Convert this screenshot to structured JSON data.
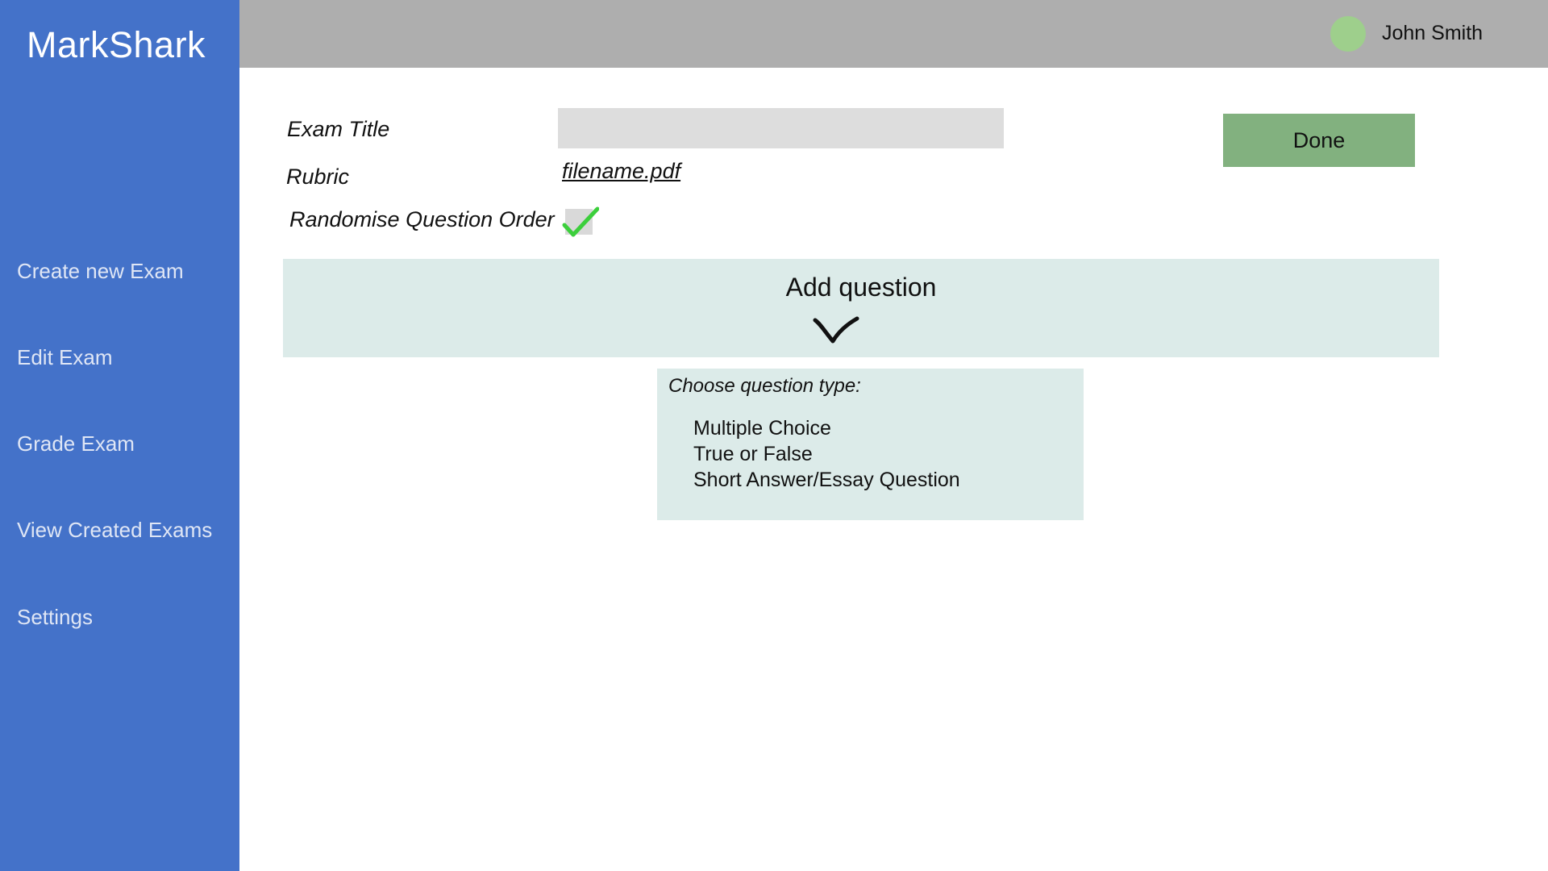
{
  "app": {
    "brand": "MarkShark"
  },
  "sidebar": {
    "items": [
      {
        "label": "Create new Exam"
      },
      {
        "label": "Edit Exam"
      },
      {
        "label": "Grade Exam"
      },
      {
        "label": "View Created Exams"
      },
      {
        "label": "Settings"
      }
    ]
  },
  "header": {
    "user_name": "John Smith",
    "avatar_icon": "user-avatar-icon"
  },
  "form": {
    "exam_title_label": "Exam Title",
    "exam_title_value": "",
    "rubric_label": "Rubric",
    "rubric_file": "filename.pdf",
    "randomise_label": "Randomise Question Order",
    "randomise_checked": true
  },
  "done_button": {
    "label": "Done"
  },
  "add_question": {
    "label": "Add question",
    "icon": "chevron-down-icon",
    "dropdown": {
      "prompt": "Choose question type:",
      "options": [
        "Multiple Choice",
        "True or False",
        "Short Answer/Essay Question"
      ]
    }
  },
  "colors": {
    "sidebar": "#4472c9",
    "header": "#aeaeae",
    "done_button": "#82b17f",
    "panel": "#dcebe9",
    "checkmark": "#3ccf3c",
    "avatar": "#9ecf8c"
  }
}
